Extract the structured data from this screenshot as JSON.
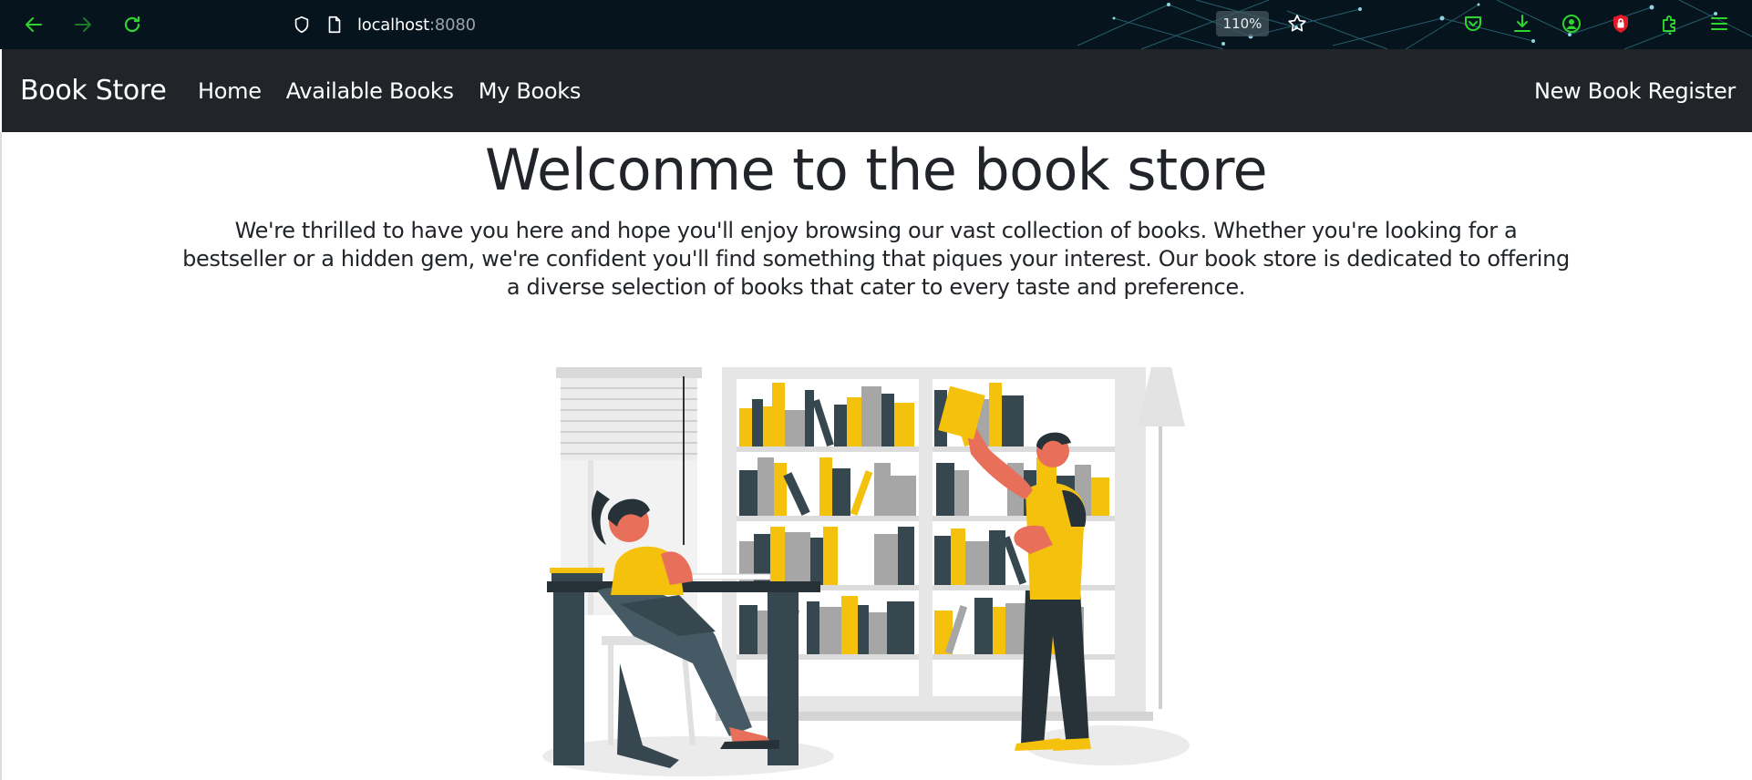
{
  "browser": {
    "url_host": "localhost",
    "url_port": ":8080",
    "zoom": "110%",
    "icons": {
      "back": "back-arrow-icon",
      "forward": "forward-arrow-icon",
      "reload": "reload-icon",
      "shield": "tracking-protection-shield-icon",
      "page": "page-info-icon",
      "bookmark": "bookmark-star-icon",
      "pocket": "pocket-icon",
      "downloads": "download-icon",
      "account": "account-icon",
      "lock_ext": "red-lock-extension-icon",
      "extensions": "extensions-puzzle-icon",
      "menu": "hamburger-menu-icon"
    },
    "accent_color": "#2ed52e"
  },
  "navbar": {
    "brand": "Book Store",
    "links": [
      "Home",
      "Available Books",
      "My Books"
    ],
    "right_link": "New Book Register",
    "background": "#212529"
  },
  "main": {
    "title": "Welconme to the book store",
    "intro": "We're thrilled to have you here and hope you'll enjoy browsing our vast collection of books. Whether you're looking for a bestseller or a hidden gem, we're confident you'll find something that piques your interest. Our book store is dedicated to offering a diverse selection of books that cater to every taste and preference.",
    "illustration": "bookstore-reading-illustration",
    "palette": {
      "yellow": "#f4c20d",
      "dark_teal": "#37474f",
      "gray": "#a6a6a6",
      "skin": "#e8705a"
    }
  }
}
